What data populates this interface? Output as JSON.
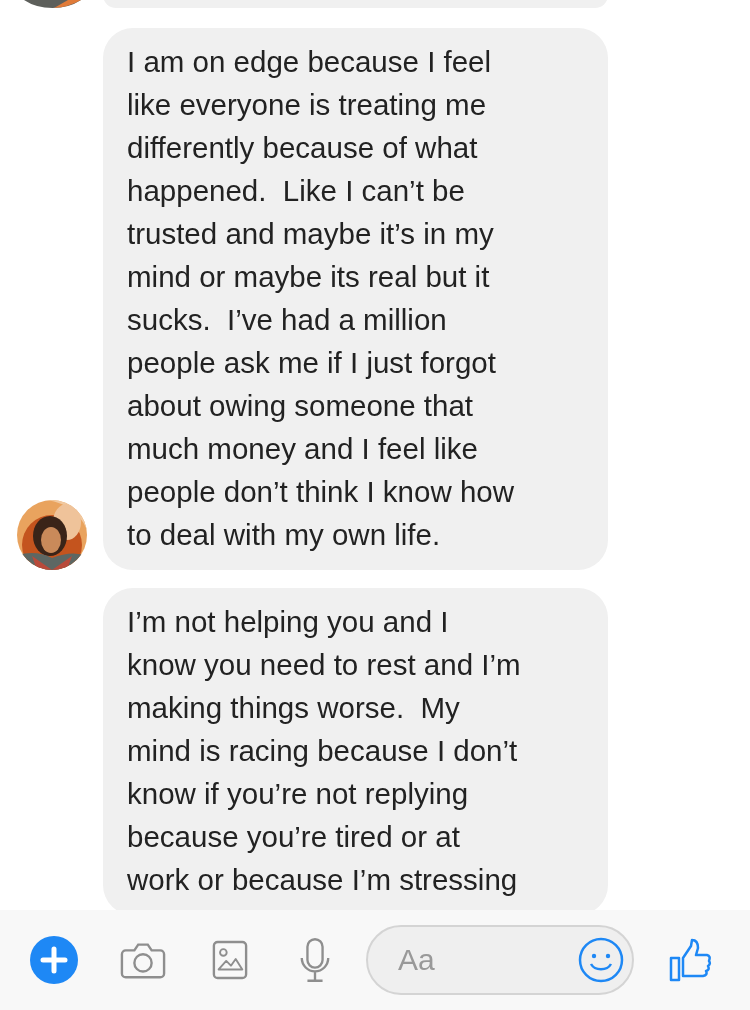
{
  "messages": [
    {
      "text": "I am on edge because I feel\nlike everyone is treating me\ndifferently because of what\nhappened.  Like I can’t be\ntrusted and maybe it’s in my\nmind or maybe its real but it\nsucks.  I’ve had a million\npeople ask me if I just forgot\nabout owing someone that\nmuch money and I feel like\npeople don’t think I know how\nto deal with my own life.",
      "avatar": true
    },
    {
      "text": "I’m not helping you and I\nknow you need to rest and I’m\nmaking things worse.  My\nmind is racing because I don’t\nknow if you’re not replying\nbecause you’re tired or at\nwork or because I’m stressing",
      "avatar": false
    }
  ],
  "composer": {
    "placeholder": "Aa"
  }
}
